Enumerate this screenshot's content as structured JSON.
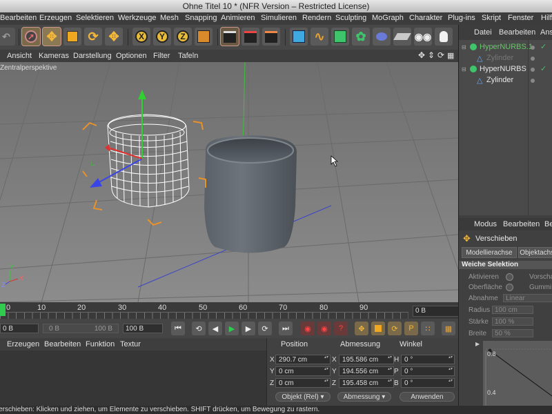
{
  "window": {
    "title": "Ohne Titel 10 * (NFR Version – Restricted License)"
  },
  "menubar": {
    "items": [
      "Bearbeiten",
      "Erzeugen",
      "Selektieren",
      "Werkzeuge",
      "Mesh",
      "Snapping",
      "Animieren",
      "Simulieren",
      "Rendern",
      "Sculpting",
      "MoGraph",
      "Charakter",
      "Plug-ins",
      "Skript",
      "Fenster",
      "Hilfe"
    ]
  },
  "toolbar": {
    "x_axis": "X",
    "y_axis": "Y",
    "z_axis": "Z"
  },
  "viewmenu": {
    "items": [
      "Ansicht",
      "Kameras",
      "Darstellung",
      "Optionen",
      "Filter",
      "Tafeln"
    ]
  },
  "viewport": {
    "label": "Zentralperspektive",
    "axis_x": "X",
    "axis_y": "Y",
    "axis_z": "Z"
  },
  "timeline": {
    "ticks": [
      "0",
      "10",
      "20",
      "30",
      "40",
      "50",
      "60",
      "70",
      "80",
      "90"
    ],
    "current_frame": "0 B"
  },
  "transport": {
    "start": "0 B",
    "min": "0 B",
    "max": "100 B",
    "end": "100 B"
  },
  "material_menu": {
    "items": [
      "Erzeugen",
      "Bearbeiten",
      "Funktion",
      "Textur"
    ]
  },
  "coordinates": {
    "headers": {
      "position": "Position",
      "size": "Abmessung",
      "rotation": "Winkel"
    },
    "rows": [
      {
        "axis": "X",
        "pos": "290.7 cm",
        "size_axis": "X",
        "size": "195.586 cm",
        "rot_axis": "H",
        "rot": "0 °"
      },
      {
        "axis": "Y",
        "pos": "0 cm",
        "size_axis": "Y",
        "size": "194.556 cm",
        "rot_axis": "P",
        "rot": "0 °"
      },
      {
        "axis": "Z",
        "pos": "0 cm",
        "size_axis": "Z",
        "size": "195.458 cm",
        "rot_axis": "B",
        "rot": "0 °"
      }
    ],
    "mode_select": "Objekt (Rel)",
    "size_select": "Abmessung",
    "apply_label": "Anwenden"
  },
  "status": {
    "text": "Verschieben: Klicken und ziehen, um Elemente zu verschieben. SHIFT drücken, um Bewegung zu rastern."
  },
  "object_manager": {
    "menu": [
      "Datei",
      "Bearbeiten",
      "Ansicht"
    ],
    "objects": [
      {
        "name": "HyperNURBS.1",
        "level": 0,
        "color": "#5fcc5f"
      },
      {
        "name": "Zylinder",
        "level": 1,
        "color": "#777777"
      },
      {
        "name": "HyperNURBS",
        "level": 0,
        "color": "#e8e8e8"
      },
      {
        "name": "Zylinder",
        "level": 1,
        "color": "#e8e8e8"
      }
    ]
  },
  "attributes": {
    "menu": [
      "Modus",
      "Bearbeiten",
      "Benutzer"
    ],
    "tool_name": "Verschieben",
    "tabs": [
      "Modellierachse",
      "Objektachse"
    ],
    "section": "Weiche Selektion",
    "activate_label": "Aktivieren",
    "preview_label": "Vorschau",
    "surface_label": "Oberfläche",
    "rubber_label": "Gummi",
    "falloff_label": "Abnahme",
    "falloff_value": "Linear",
    "radius_label": "Radius",
    "radius_value": "100 cm",
    "strength_label": "Stärke",
    "strength_value": "100 %",
    "width_label": "Breite",
    "width_value": "50 %",
    "graph_labels": [
      "0.8",
      "0.4"
    ]
  }
}
